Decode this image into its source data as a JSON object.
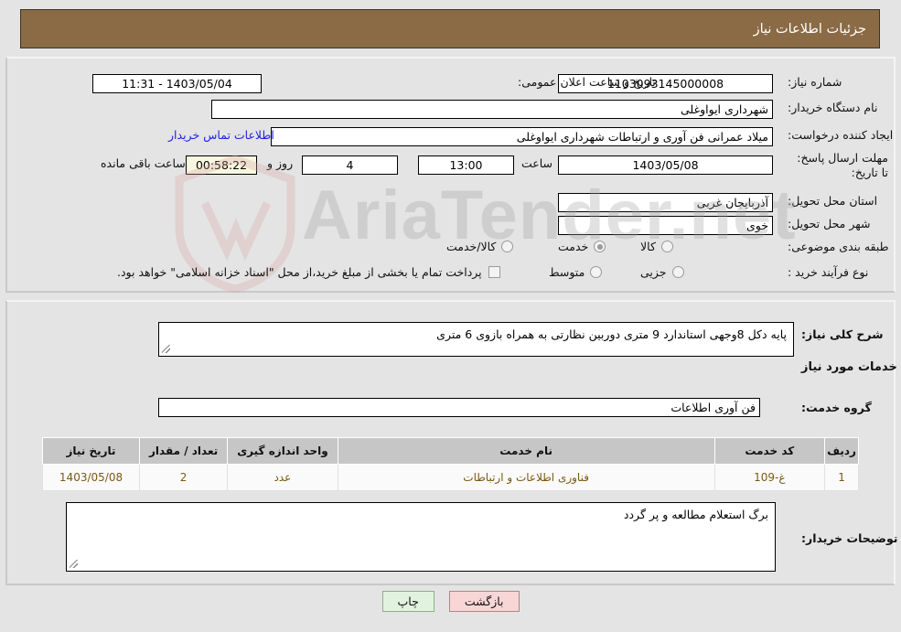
{
  "header": {
    "title": "جزئیات اطلاعات نیاز"
  },
  "top_form": {
    "need_number_label": "شماره نیاز:",
    "need_number_value": "1103093145000008",
    "public_announce_label": "تاریخ و ساعت اعلان عمومی:",
    "public_announce_value": "1403/05/04 - 11:31",
    "buyer_org_label": "نام دستگاه خریدار:",
    "buyer_org_value": "شهرداری ایواوغلی",
    "requester_label": "ایجاد کننده درخواست:",
    "requester_value": "میلاد عمرانی فن آوری و ارتباطات شهرداری ایواوغلی",
    "contact_link": "اطلاعات تماس خریدار",
    "deadline_label": "مهلت ارسال پاسخ: تا تاریخ:",
    "deadline_date": "1403/05/08",
    "deadline_hour_label": "ساعت",
    "deadline_hour_value": "13:00",
    "days_value": "4",
    "days_label": "روز و",
    "countdown_value": "00:58:22",
    "remaining_label": "ساعت باقی مانده",
    "province_label": "استان محل تحویل:",
    "province_value": "آذربایجان غربی",
    "city_label": "شهر محل تحویل:",
    "city_value": "خوی",
    "category_label": "طبقه بندی موضوعی:",
    "category_options": [
      {
        "label": "کالا",
        "selected": false
      },
      {
        "label": "خدمت",
        "selected": true
      },
      {
        "label": "کالا/خدمت",
        "selected": false
      }
    ],
    "process_label": "نوع فرآیند خرید :",
    "process_options": [
      {
        "label": "جزیی",
        "selected": false
      },
      {
        "label": "متوسط",
        "selected": false
      }
    ],
    "treasury_checkbox_label": "پرداخت تمام یا بخشی از مبلغ خرید،از محل \"اسناد خزانه اسلامی\" خواهد بود.",
    "treasury_checked": false
  },
  "middle": {
    "summary_label": "شرح کلی نیاز:",
    "summary_value": "پایه دکل 8وجهی استاندارد 9 متری دوربین نظارتی به همراه بازوی 6 متری",
    "services_heading": "اطلاعات خدمات مورد نیاز",
    "service_group_label": "گروه خدمت:",
    "service_group_value": "فن آوری اطلاعات",
    "buyer_notes_label": "توضیحات خریدار:",
    "buyer_notes_value": "برگ استعلام مطالعه و پر گردد"
  },
  "table": {
    "columns": [
      "ردیف",
      "کد خدمت",
      "نام خدمت",
      "واحد اندازه گیری",
      "تعداد / مقدار",
      "تاریخ نیاز"
    ],
    "rows": [
      {
        "radif": "1",
        "code": "غ-109",
        "name": "فناوری اطلاعات و ارتباطات",
        "unit": "عدد",
        "qty": "2",
        "date": "1403/05/08"
      }
    ]
  },
  "buttons": {
    "back": "بازگشت",
    "print": "چاپ"
  },
  "watermark": {
    "text": "AriaTender.net"
  },
  "colors": {
    "header_bg": "#8b6b45",
    "page_bg": "#e4e4e4",
    "link": "#2222dd",
    "table_header_bg": "#c6c6c6",
    "cell_text": "#7a5a12",
    "back_btn_bg": "#f8d6d6",
    "print_btn_bg": "#e1f3df",
    "countdown_bg": "#f7f7e0"
  }
}
